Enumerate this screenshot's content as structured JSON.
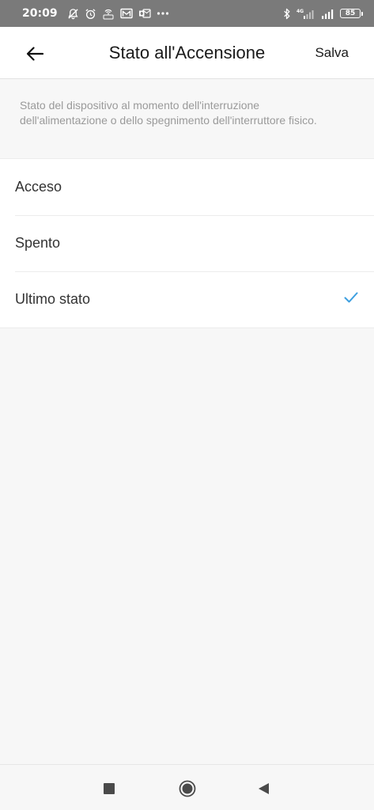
{
  "status_bar": {
    "time": "20:09",
    "battery_level": "85",
    "icons_left": [
      "bell-off-icon",
      "alarm-icon",
      "hotspot-icon",
      "mail-icon",
      "outlook-icon",
      "more-dots-icon"
    ],
    "icons_right": [
      "bluetooth-icon",
      "signal-4g-icon",
      "signal-icon",
      "battery-icon"
    ]
  },
  "header": {
    "title": "Stato all'Accensione",
    "save_label": "Salva",
    "back_icon": "arrow-left-icon"
  },
  "description": "Stato del dispositivo al momento dell'interruzione dell'alimentazione o dello spegnimento dell'interruttore fisico.",
  "options": [
    {
      "label": "Acceso",
      "selected": false
    },
    {
      "label": "Spento",
      "selected": false
    },
    {
      "label": "Ultimo stato",
      "selected": true
    }
  ],
  "colors": {
    "accent": "#3d9fe0",
    "status_bar": "#7a7a7a",
    "description_text": "#9a9a9a"
  },
  "nav_bar": {
    "icons": [
      "recents-square-icon",
      "home-circle-icon",
      "back-triangle-icon"
    ]
  }
}
